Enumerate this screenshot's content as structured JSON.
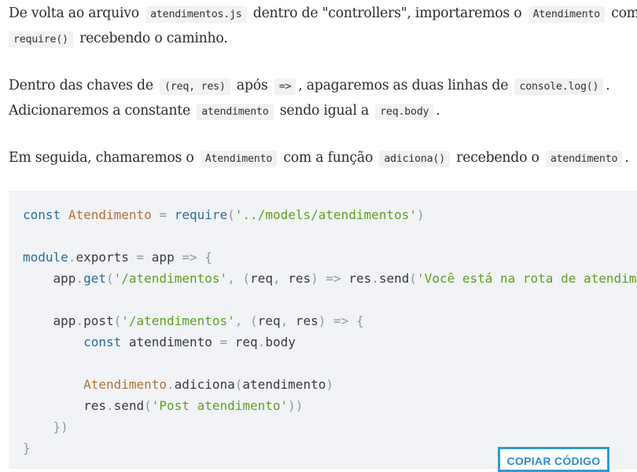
{
  "paragraphs": {
    "p1": {
      "t1": "De volta ao arquivo",
      "c1": "atendimentos.js",
      "t2": "dentro de \"controllers\", importaremos o",
      "c2": "Atendimento",
      "t3": "com",
      "c3": "require()",
      "t4": "recebendo o caminho."
    },
    "p2": {
      "t1": "Dentro das chaves de",
      "c1": "(req, res)",
      "t2": "após",
      "c2": "=>",
      "t3": ", apagaremos as duas linhas de",
      "c3": "console.log()",
      "t4": ".",
      "t5": "Adicionaremos a constante",
      "c4": "atendimento",
      "t6": "sendo igual a",
      "c5": "req.body",
      "t7": "."
    },
    "p3": {
      "t1": "Em seguida, chamaremos o",
      "c1": "Atendimento",
      "t2": "com a função",
      "c2": "adiciona()",
      "t3": "recebendo o",
      "c3": "atendimento",
      "t4": "."
    }
  },
  "code": {
    "l1": {
      "kw": "const",
      "name": "Atendimento",
      "eq": "=",
      "fn": "require",
      "p1": "(",
      "str": "'../models/atendimentos'",
      "p2": ")"
    },
    "l3": {
      "obj": "module",
      "dot": ".",
      "prop": "exports",
      "eq": "=",
      "arg": "app",
      "arrow": "=>",
      "brace": "{"
    },
    "l4": {
      "indent": "    ",
      "obj": "app",
      "dot": ".",
      "fn": "get",
      "p1": "(",
      "str": "'/atendimentos'",
      "comma": ",",
      "p2": "(",
      "a1": "req",
      "comma2": ",",
      "a2": "res",
      "p3": ")",
      "arrow": "=>",
      "obj2": "res",
      "dot2": ".",
      "fn2": "send",
      "p4": "(",
      "str2": "'Você está na rota de atendimentos e está realizando um GET'",
      "p5": "))"
    },
    "l6": {
      "indent": "    ",
      "obj": "app",
      "dot": ".",
      "fn": "post",
      "p1": "(",
      "str": "'/atendimentos'",
      "comma": ",",
      "p2": "(",
      "a1": "req",
      "comma2": ",",
      "a2": "res",
      "p3": ")",
      "arrow": "=>",
      "brace": "{"
    },
    "l7": {
      "indent": "        ",
      "kw": "const",
      "name": "atendimento",
      "eq": "=",
      "obj": "req",
      "dot": ".",
      "prop": "body"
    },
    "l9": {
      "indent": "        ",
      "cls": "Atendimento",
      "dot": ".",
      "fn": "adiciona",
      "p1": "(",
      "arg": "atendimento",
      "p2": ")"
    },
    "l10": {
      "indent": "        ",
      "obj": "res",
      "dot": ".",
      "fn": "send",
      "p1": "(",
      "str": "'Post atendimento'",
      "p2": "))"
    },
    "l11": {
      "indent": "    ",
      "close": "})"
    },
    "l12": {
      "close": "}"
    }
  },
  "copy_button": {
    "label": "COPIAR CÓDIGO"
  },
  "colors": {
    "keyword": "#2d6b96",
    "class": "#b2703a",
    "string": "#5f9e26",
    "operator": "#8e97a3",
    "button": "#2f9bd6"
  }
}
